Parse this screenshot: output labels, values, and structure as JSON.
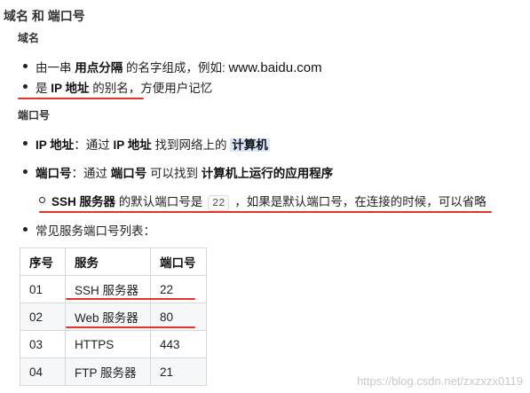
{
  "heading": "域名 和 端口号",
  "section1": {
    "title": "域名",
    "b1": {
      "prefix": "由一串 ",
      "bold": "用点分隔",
      "mid": " 的名字组成，例如: ",
      "url": "www.baidu.com"
    },
    "b2": {
      "prefix": "是 ",
      "bold": "IP 地址",
      "suffix": " 的别名，方便用户记忆"
    }
  },
  "section2": {
    "title": "端口号",
    "b1": {
      "bold1": "IP 地址",
      "mid1": "：通过 ",
      "bold2": "IP 地址",
      "mid2": " 找到网络上的 ",
      "highlight": "计算机"
    },
    "b2": {
      "bold1": "端口号",
      "mid1": "：通过 ",
      "bold2": "端口号",
      "mid2": " 可以找到 ",
      "bold3": "计算机上运行的应用程序"
    },
    "sub": {
      "bold": "SSH 服务器",
      "mid": " 的默认端口号是 ",
      "code": "22",
      "suffix": " ，如果是默认端口号，在连接的时候，可以省略"
    },
    "b3": "常见服务端口号列表："
  },
  "table": {
    "headers": [
      "序号",
      "服务",
      "端口号"
    ],
    "rows": [
      [
        "01",
        "SSH 服务器",
        "22"
      ],
      [
        "02",
        "Web 服务器",
        "80"
      ],
      [
        "03",
        "HTTPS",
        "443"
      ],
      [
        "04",
        "FTP 服务器",
        "21"
      ]
    ]
  },
  "watermark": "https://blog.csdn.net/zxzxzx0119",
  "colors": {
    "underline": "#e6332a",
    "highlight": "#d6e6fb"
  }
}
